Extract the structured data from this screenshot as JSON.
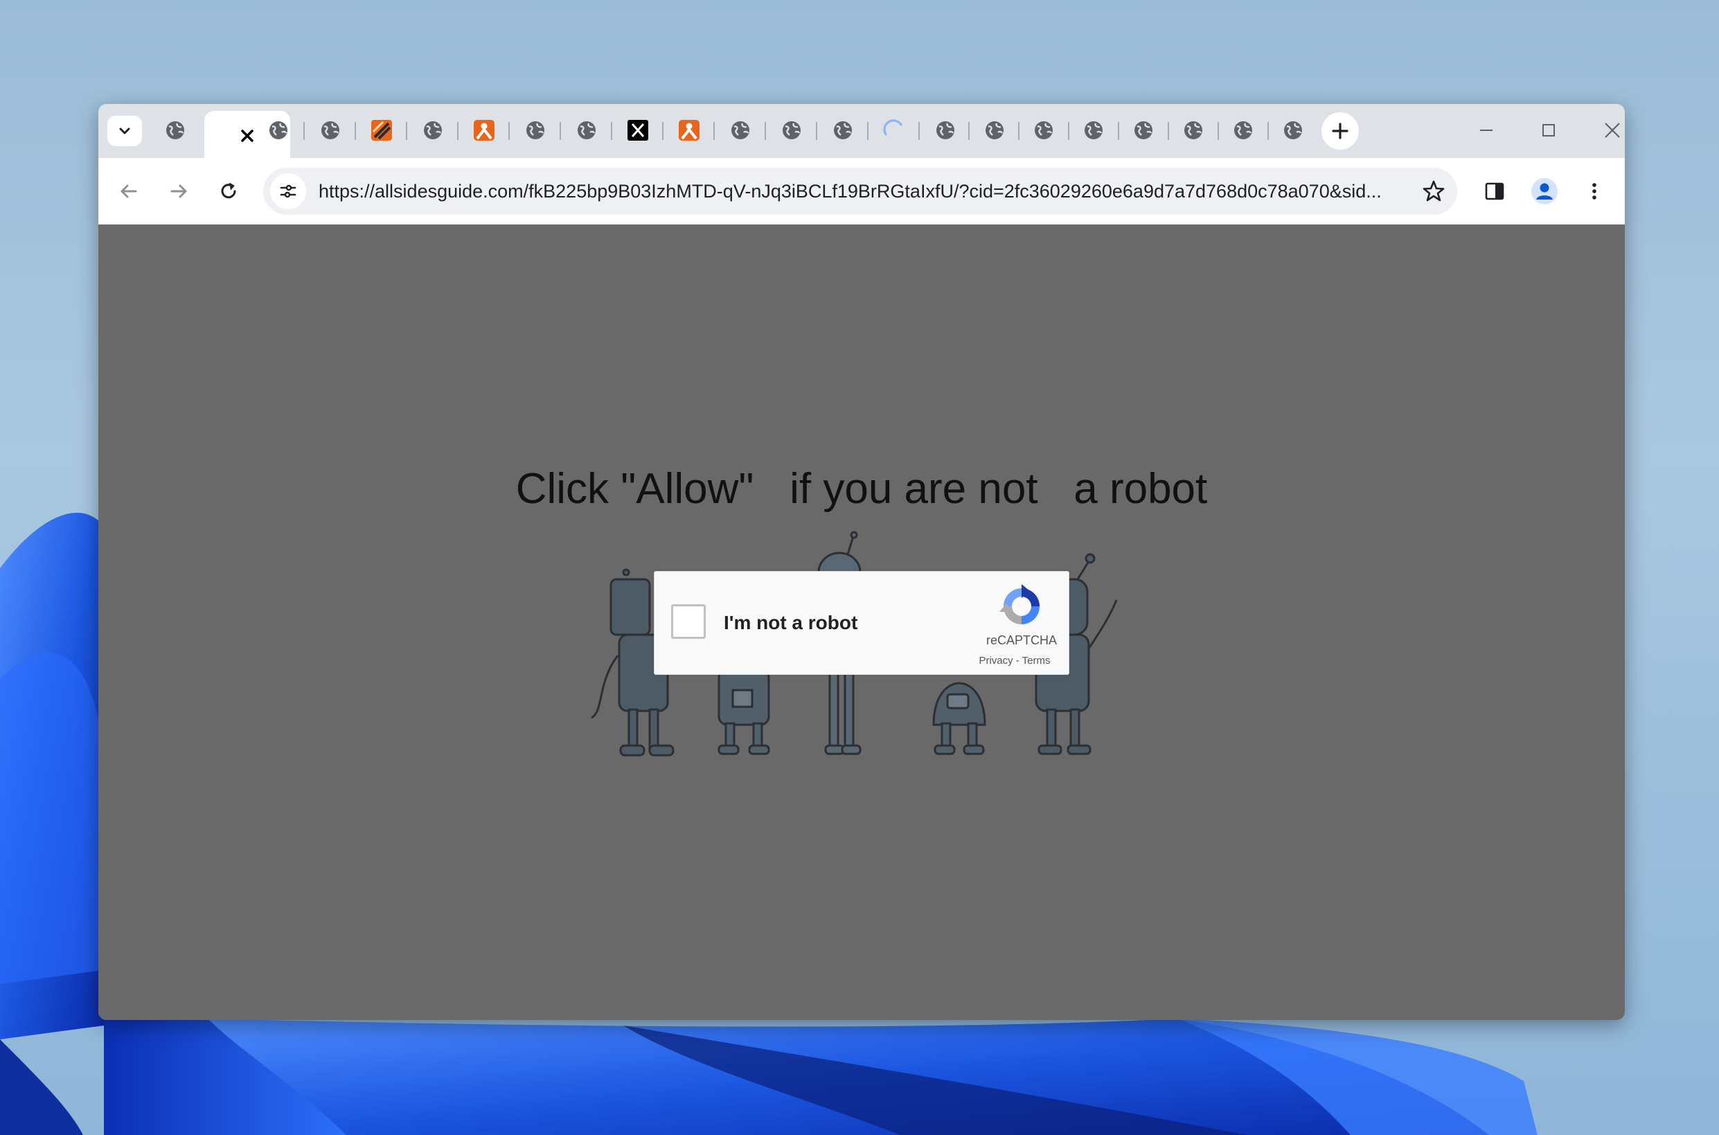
{
  "browser": {
    "tabs": [
      {
        "icon": "globe-icon"
      },
      {
        "icon": "close-icon",
        "active": true
      },
      {
        "icon": "globe-icon"
      },
      {
        "icon": "globe-icon"
      },
      {
        "icon": "orange-slash-icon"
      },
      {
        "icon": "globe-icon"
      },
      {
        "icon": "orange-person-icon"
      },
      {
        "icon": "globe-icon"
      },
      {
        "icon": "globe-icon"
      },
      {
        "icon": "x-logo-icon"
      },
      {
        "icon": "orange-person-icon"
      },
      {
        "icon": "globe-icon"
      },
      {
        "icon": "globe-icon"
      },
      {
        "icon": "globe-icon"
      },
      {
        "icon": "loading-spinner-icon"
      },
      {
        "icon": "globe-icon"
      },
      {
        "icon": "globe-icon"
      },
      {
        "icon": "globe-icon"
      },
      {
        "icon": "globe-icon"
      },
      {
        "icon": "globe-icon"
      },
      {
        "icon": "globe-icon"
      },
      {
        "icon": "globe-icon"
      },
      {
        "icon": "globe-icon"
      }
    ],
    "toolbar": {
      "url": "https://allsidesguide.com/fkB225bp9B03IzhMTD-qV-nJq3iBCLf19BrRGtaIxfU/?cid=2fc36029260e6a9d7a7d768d0c78a070&sid..."
    }
  },
  "page": {
    "headline": "Click \"Allow\"   if you are not   a robot",
    "recaptcha": {
      "label": "I'm not a robot",
      "brand": "reCAPTCHA",
      "links": "Privacy - Terms",
      "checked": false
    }
  },
  "colors": {
    "page_background": "#696969",
    "tabstrip": "#dee1e6",
    "accent_blue": "#1a73e8",
    "favicon_orange": "#e8661c",
    "desktop_blue": "#1e5fe6"
  }
}
